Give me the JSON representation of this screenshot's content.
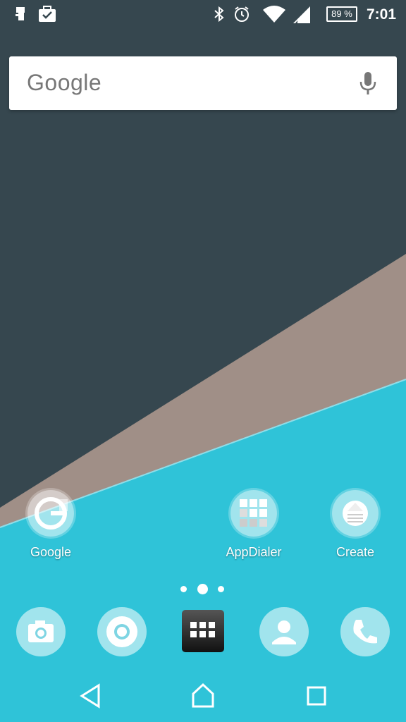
{
  "status_bar": {
    "time": "7:01",
    "battery_percent": "89 %",
    "icons": [
      "usb-debug-icon",
      "briefcase-check-icon",
      "bluetooth-icon",
      "alarm-icon",
      "wifi-icon",
      "signal-icon",
      "battery-icon"
    ]
  },
  "search": {
    "logo_text": "Google",
    "mic_icon": "mic-icon"
  },
  "home_apps": [
    {
      "label": "Google"
    },
    {
      "label": "AppDialer"
    },
    {
      "label": "Create"
    }
  ],
  "page_indicator": {
    "pages": 3,
    "current": 2
  },
  "dock": {
    "items": [
      "camera-icon",
      "chrome-icon",
      "app-drawer-icon",
      "contacts-icon",
      "phone-icon"
    ]
  },
  "nav": {
    "items": [
      "back-icon",
      "home-icon",
      "recents-icon"
    ]
  },
  "colors": {
    "wallpaper_dark": "#36474f",
    "wallpaper_brown": "#a08f87",
    "wallpaper_cyan": "#2fc3d8"
  }
}
